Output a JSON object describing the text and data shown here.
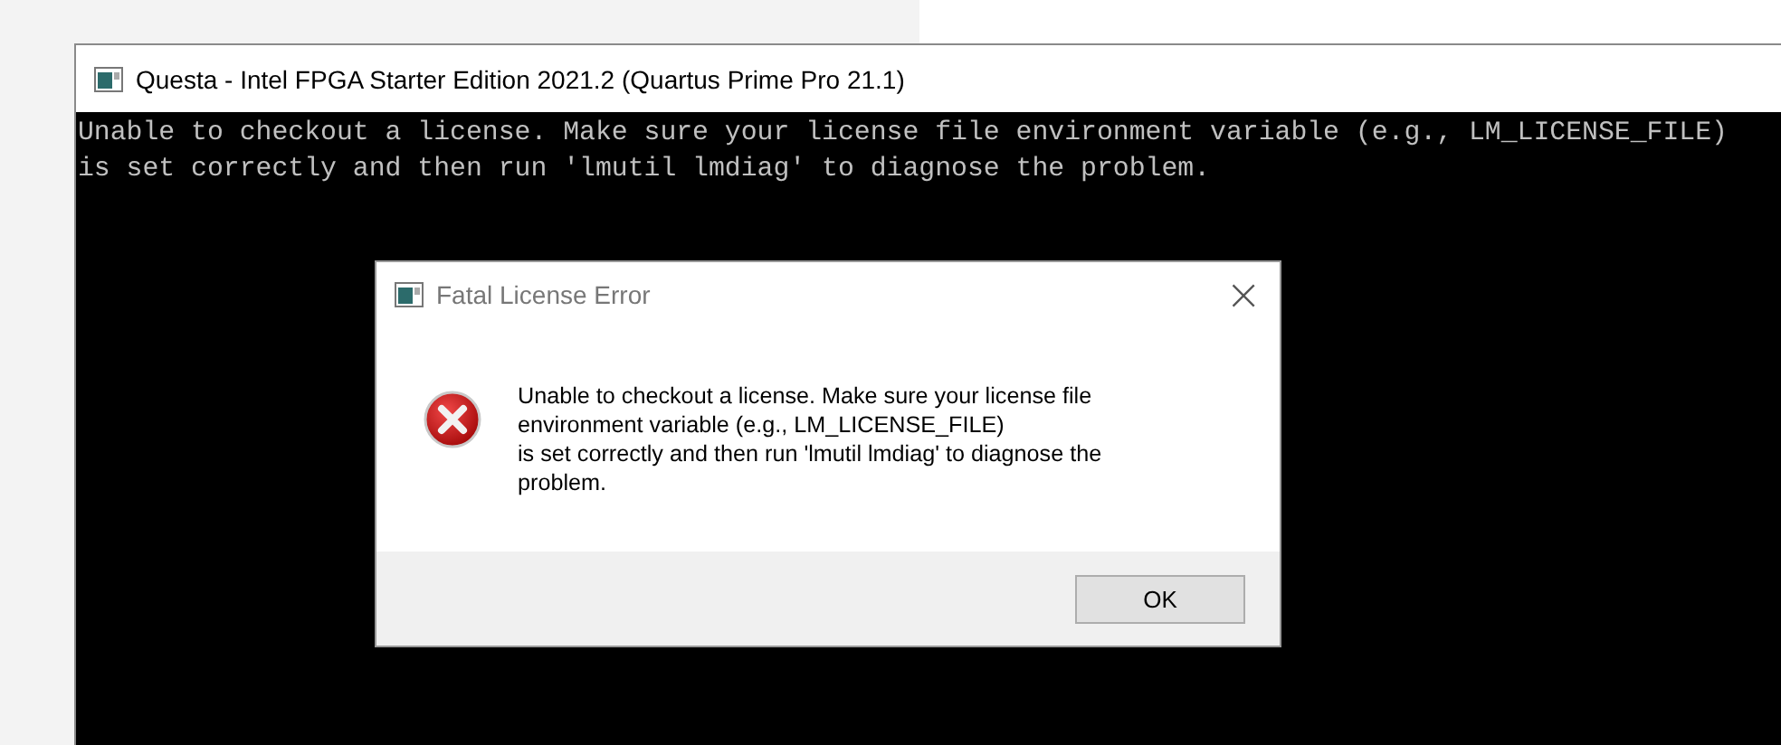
{
  "window": {
    "title": "Questa - Intel FPGA Starter Edition 2021.2 (Quartus Prime Pro 21.1)"
  },
  "console": {
    "lines": [
      "Unable to checkout a license. Make sure your license file environment variable (e.g., LM_LICENSE_FILE)",
      "is set correctly and then run 'lmutil lmdiag' to diagnose the problem."
    ]
  },
  "dialog": {
    "title": "Fatal License Error",
    "close": "×",
    "message": "Unable to checkout a license. Make sure your license file\nenvironment variable (e.g., LM_LICENSE_FILE)\nis set correctly and then run 'lmutil lmdiag' to diagnose the\nproblem.",
    "buttons": [
      "OK"
    ]
  }
}
